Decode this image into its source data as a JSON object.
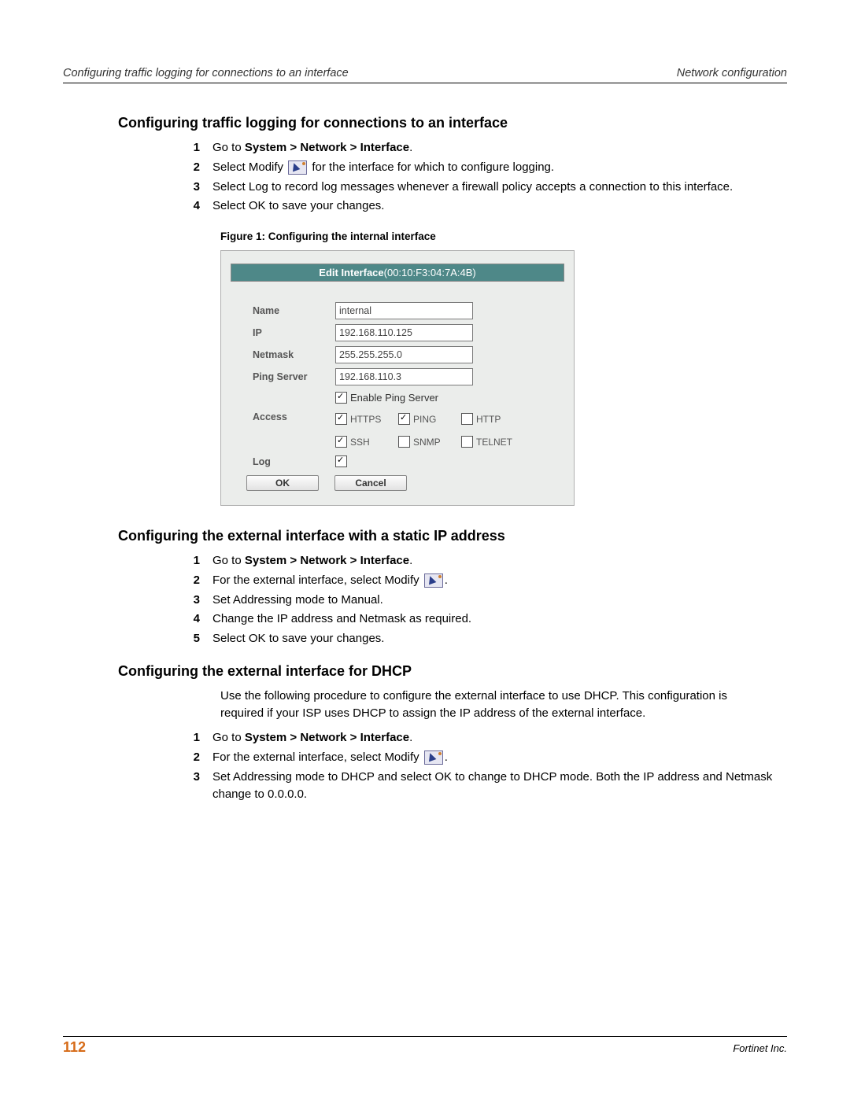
{
  "header": {
    "left": "Configuring traffic logging for connections to an interface",
    "right": "Network configuration"
  },
  "section1": {
    "title": "Configuring traffic logging for connections to an interface",
    "steps": [
      {
        "pre": "Go to ",
        "bold": "System > Network > Interface",
        "post": "."
      },
      {
        "pre": "Select Modify ",
        "icon": true,
        "post": " for the interface for which to configure logging."
      },
      {
        "text": "Select Log to record log messages whenever a firewall policy accepts a connection to this interface."
      },
      {
        "text": "Select OK to save your changes."
      }
    ],
    "figure_caption": "Figure 1:   Configuring the internal interface"
  },
  "figure": {
    "title": "Edit Interface",
    "mac": "(00:10:F3:04:7A:4B)",
    "fields": {
      "name_label": "Name",
      "name_value": "internal",
      "ip_label": "IP",
      "ip_value": "192.168.110.125",
      "netmask_label": "Netmask",
      "netmask_value": "255.255.255.0",
      "ping_label": "Ping Server",
      "ping_value": "192.168.110.3",
      "enable_ping_label": "Enable Ping Server",
      "enable_ping_checked": true,
      "access_label": "Access",
      "access": {
        "https": {
          "label": "HTTPS",
          "checked": true
        },
        "ping": {
          "label": "PING",
          "checked": true
        },
        "http": {
          "label": "HTTP",
          "checked": false
        },
        "ssh": {
          "label": "SSH",
          "checked": true
        },
        "snmp": {
          "label": "SNMP",
          "checked": false
        },
        "telnet": {
          "label": "TELNET",
          "checked": false
        }
      },
      "log_label": "Log",
      "log_checked": true,
      "ok_label": "OK",
      "cancel_label": "Cancel"
    }
  },
  "section2": {
    "title": "Configuring the external interface with a static IP address",
    "steps": [
      {
        "pre": "Go to ",
        "bold": "System > Network > Interface",
        "post": "."
      },
      {
        "pre": "For the external interface, select Modify ",
        "icon": true,
        "post": "."
      },
      {
        "text": "Set Addressing mode to Manual."
      },
      {
        "text": "Change the IP address and Netmask as required."
      },
      {
        "text": "Select OK to save your changes."
      }
    ]
  },
  "section3": {
    "title": "Configuring the external interface for DHCP",
    "intro": "Use the following procedure to configure the external interface to use DHCP. This configuration is required if your ISP uses DHCP to assign the IP address of the external interface.",
    "steps": [
      {
        "pre": "Go to ",
        "bold": "System > Network > Interface",
        "post": "."
      },
      {
        "pre": "For the external interface, select Modify ",
        "icon": true,
        "post": "."
      },
      {
        "text": "Set Addressing mode to DHCP and select OK to change to DHCP mode. Both the IP address and Netmask change to 0.0.0.0."
      }
    ]
  },
  "footer": {
    "page": "112",
    "company": "Fortinet Inc."
  }
}
